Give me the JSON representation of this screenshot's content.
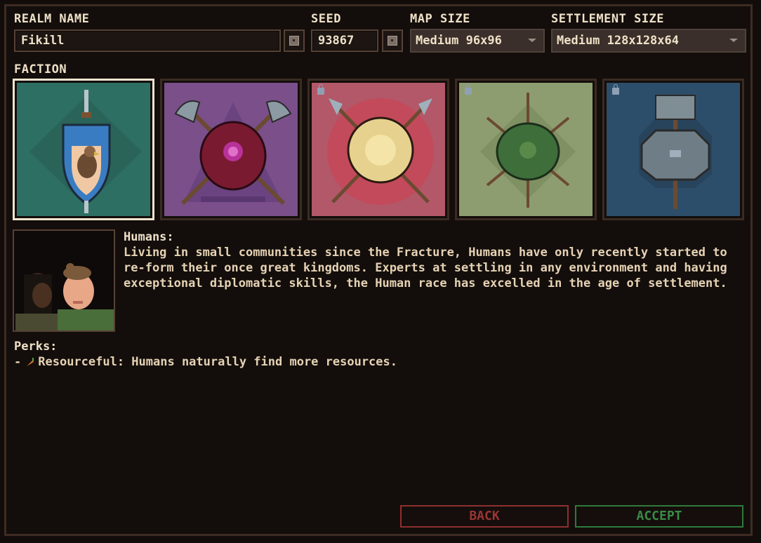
{
  "labels": {
    "realm_name": "REALM NAME",
    "seed": "SEED",
    "map_size": "MAP SIZE",
    "settlement_size": "SETTLEMENT SIZE",
    "faction": "FACTION"
  },
  "fields": {
    "realm_name_value": "Fikill",
    "seed_value": "93867",
    "map_size_selected": "Medium 96x96",
    "settlement_size_selected": "Medium 128x128x64"
  },
  "factions": [
    {
      "id": "humans",
      "icon": "sword-hawk-shield-icon",
      "color": "#2e6f63",
      "locked": false,
      "selected": true
    },
    {
      "id": "faction-2",
      "icon": "axes-shield-icon",
      "color": "#7a4f8a",
      "locked": false,
      "selected": false
    },
    {
      "id": "faction-3",
      "icon": "spears-sun-shield-icon",
      "color": "#b25868",
      "locked": true,
      "selected": false
    },
    {
      "id": "faction-4",
      "icon": "arrows-turtle-shell-icon",
      "color": "#8e9d70",
      "locked": true,
      "selected": false
    },
    {
      "id": "faction-5",
      "icon": "stone-hammer-icon",
      "color": "#2d4e6a",
      "locked": true,
      "selected": false
    }
  ],
  "description": {
    "title": "Humans:",
    "text": "Living in small communities since the Fracture, Humans have only recently started to\nre-form their once great kingdoms. Experts at settling in any environment and having\nexceptional diplomatic skills, the Human race has excelled in the age of settlement."
  },
  "perks": {
    "title": "Perks:",
    "items": [
      {
        "prefix": "-",
        "icon": "carrot-icon",
        "text": "Resourceful: Humans naturally find more resources."
      }
    ]
  },
  "buttons": {
    "back": "BACK",
    "accept": "ACCEPT"
  }
}
